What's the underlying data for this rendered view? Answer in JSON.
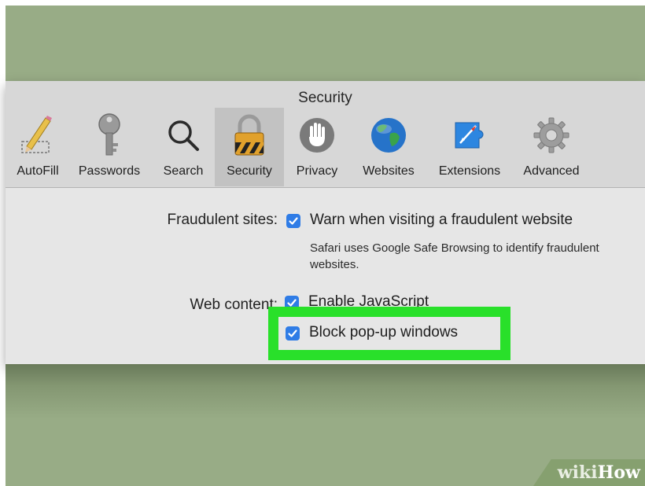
{
  "window": {
    "title": "Security"
  },
  "toolbar": {
    "tabs": [
      {
        "label": "AutoFill",
        "icon": "autofill-icon"
      },
      {
        "label": "Passwords",
        "icon": "key-icon"
      },
      {
        "label": "Search",
        "icon": "magnifier-icon"
      },
      {
        "label": "Security",
        "icon": "lock-icon",
        "selected": true
      },
      {
        "label": "Privacy",
        "icon": "hand-icon"
      },
      {
        "label": "Websites",
        "icon": "globe-icon"
      },
      {
        "label": "Extensions",
        "icon": "extensions-puzzle-icon"
      },
      {
        "label": "Advanced",
        "icon": "gear-icon"
      }
    ]
  },
  "fraudulent": {
    "label": "Fraudulent sites:",
    "option": "Warn when visiting a fraudulent website",
    "checked": true,
    "note": "Safari uses Google Safe Browsing to identify fraudulent websites."
  },
  "web_content": {
    "label": "Web content:",
    "javascript": "Enable JavaScript",
    "javascript_checked": true,
    "popups": "Block pop-up windows",
    "popups_checked": true
  },
  "watermark": {
    "text_wiki": "wiki",
    "text_how": "How"
  },
  "colors": {
    "highlight": "#29e02a",
    "checkbox": "#2f7ce6",
    "desktop": "#98ac86"
  }
}
